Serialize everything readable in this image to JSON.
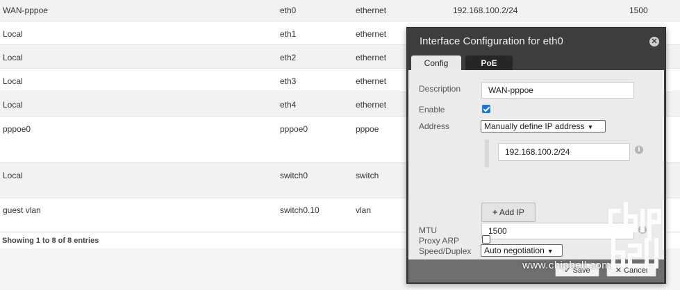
{
  "table": {
    "rows": [
      {
        "name": "WAN-pppoe",
        "iface": "eth0",
        "type": "ethernet",
        "address": "192.168.100.2/24",
        "mtu": "1500"
      },
      {
        "name": "Local",
        "iface": "eth1",
        "type": "ethernet",
        "address": "",
        "mtu": ""
      },
      {
        "name": "Local",
        "iface": "eth2",
        "type": "ethernet",
        "address": "",
        "mtu": ""
      },
      {
        "name": "Local",
        "iface": "eth3",
        "type": "ethernet",
        "address": "",
        "mtu": ""
      },
      {
        "name": "Local",
        "iface": "eth4",
        "type": "ethernet",
        "address": "",
        "mtu": ""
      },
      {
        "name": "pppoe0",
        "iface": "pppoe0",
        "type": "pppoe",
        "address": "",
        "mtu": ""
      },
      {
        "name": "Local",
        "iface": "switch0",
        "type": "switch",
        "address": "",
        "mtu": ""
      },
      {
        "name": "guest vlan",
        "iface": "switch0.10",
        "type": "vlan",
        "address": "",
        "mtu": ""
      }
    ],
    "info": "Showing 1 to 8 of 8 entries"
  },
  "dialog": {
    "title": "Interface Configuration for eth0",
    "close_icon": "close-icon",
    "tabs": [
      {
        "label": "Config",
        "active": true
      },
      {
        "label": "PoE",
        "active": false
      }
    ],
    "fields": {
      "description_label": "Description",
      "description_value": "WAN-pppoe",
      "enable_label": "Enable",
      "enable_checked": true,
      "address_label": "Address",
      "address_mode": "Manually define IP address",
      "ip_value": "192.168.100.2/24",
      "add_ip_label": "Add IP",
      "mtu_label": "MTU",
      "mtu_value": "1500",
      "speed_label": "Speed/Duplex",
      "speed_value": "Auto negotiation",
      "proxy_arp_label": "Proxy ARP",
      "proxy_arp_checked": false
    },
    "footer": {
      "save_label": "Save",
      "cancel_label": "Cancel"
    }
  },
  "watermark": {
    "url": "www.chiphell.com",
    "logo_text": "chip hell"
  },
  "colors": {
    "dialog_bg": "#3d3d3d",
    "body_bg": "#ebebeb",
    "checkbox_accent": "#1a73e8"
  }
}
